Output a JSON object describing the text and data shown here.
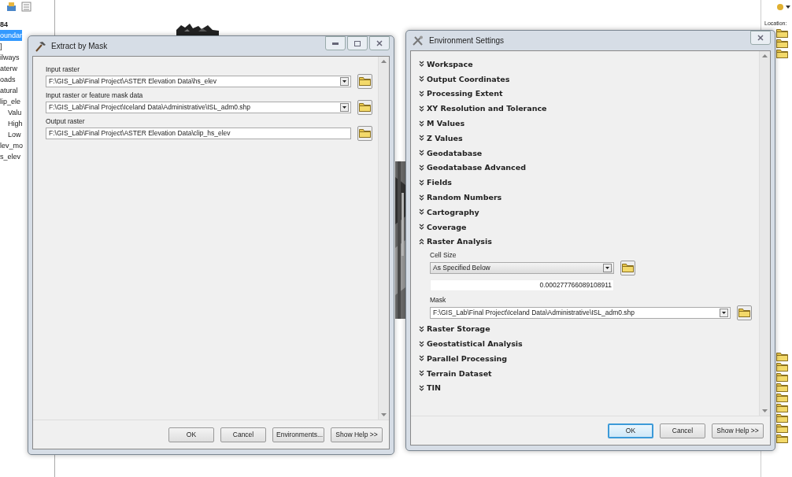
{
  "toc": {
    "items": [
      {
        "label": "84",
        "kind": "heading",
        "selected": false
      },
      {
        "label": "oundar",
        "kind": "layer",
        "selected": true
      },
      {
        "label": "]",
        "kind": "layer",
        "selected": false
      },
      {
        "label": "ilways",
        "kind": "layer",
        "selected": false
      },
      {
        "label": "aterw",
        "kind": "layer",
        "selected": false
      },
      {
        "label": "oads",
        "kind": "layer",
        "selected": false
      },
      {
        "label": "atural",
        "kind": "layer",
        "selected": false
      },
      {
        "label": "lip_ele",
        "kind": "layer",
        "selected": false
      },
      {
        "label": "Valu",
        "kind": "legend",
        "selected": false
      },
      {
        "label": "High",
        "kind": "legend",
        "selected": false
      },
      {
        "label": "Low",
        "kind": "legend",
        "selected": false
      },
      {
        "label": "lev_mo",
        "kind": "layer",
        "selected": false
      },
      {
        "label": "s_elev",
        "kind": "layer",
        "selected": false
      }
    ]
  },
  "catalog": {
    "location_label": "Location:"
  },
  "extract_window": {
    "title": "Extract by Mask",
    "fields": [
      {
        "label": "Input raster",
        "value": "F:\\GIS_Lab\\Final Project\\ASTER Elevation Data\\hs_elev",
        "kind": "dropdown"
      },
      {
        "label": "Input raster or feature mask data",
        "value": "F:\\GIS_Lab\\Final Project\\Iceland Data\\Administrative\\ISL_adm0.shp",
        "kind": "dropdown"
      },
      {
        "label": "Output raster",
        "value": "F:\\GIS_Lab\\Final Project\\ASTER Elevation Data\\clip_hs_elev",
        "kind": "text"
      }
    ],
    "buttons": [
      {
        "label": "OK",
        "default": false
      },
      {
        "label": "Cancel",
        "default": false
      },
      {
        "label": "Environments...",
        "default": false
      },
      {
        "label": "Show Help >>",
        "default": false
      }
    ]
  },
  "env_window": {
    "title": "Environment Settings",
    "sections": [
      {
        "label": "Workspace",
        "expanded": false
      },
      {
        "label": "Output Coordinates",
        "expanded": false
      },
      {
        "label": "Processing Extent",
        "expanded": false
      },
      {
        "label": "XY Resolution and Tolerance",
        "expanded": false
      },
      {
        "label": "M Values",
        "expanded": false
      },
      {
        "label": "Z Values",
        "expanded": false
      },
      {
        "label": "Geodatabase",
        "expanded": false
      },
      {
        "label": "Geodatabase Advanced",
        "expanded": false
      },
      {
        "label": "Fields",
        "expanded": false
      },
      {
        "label": "Random Numbers",
        "expanded": false
      },
      {
        "label": "Cartography",
        "expanded": false
      },
      {
        "label": "Coverage",
        "expanded": false
      },
      {
        "label": "Raster Analysis",
        "expanded": true,
        "settings": {
          "cell_size_label": "Cell Size",
          "cell_size_value": "As Specified Below",
          "cell_size_number": "0.000277766089108911",
          "mask_label": "Mask",
          "mask_value": "F:\\GIS_Lab\\Final Project\\Iceland Data\\Administrative\\ISL_adm0.shp"
        }
      },
      {
        "label": "Raster Storage",
        "expanded": false
      },
      {
        "label": "Geostatistical Analysis",
        "expanded": false
      },
      {
        "label": "Parallel Processing",
        "expanded": false
      },
      {
        "label": "Terrain Dataset",
        "expanded": false
      },
      {
        "label": "TIN",
        "expanded": false
      }
    ],
    "buttons": [
      {
        "label": "OK",
        "default": true
      },
      {
        "label": "Cancel",
        "default": false
      },
      {
        "label": "Show Help >>",
        "default": false
      }
    ]
  }
}
